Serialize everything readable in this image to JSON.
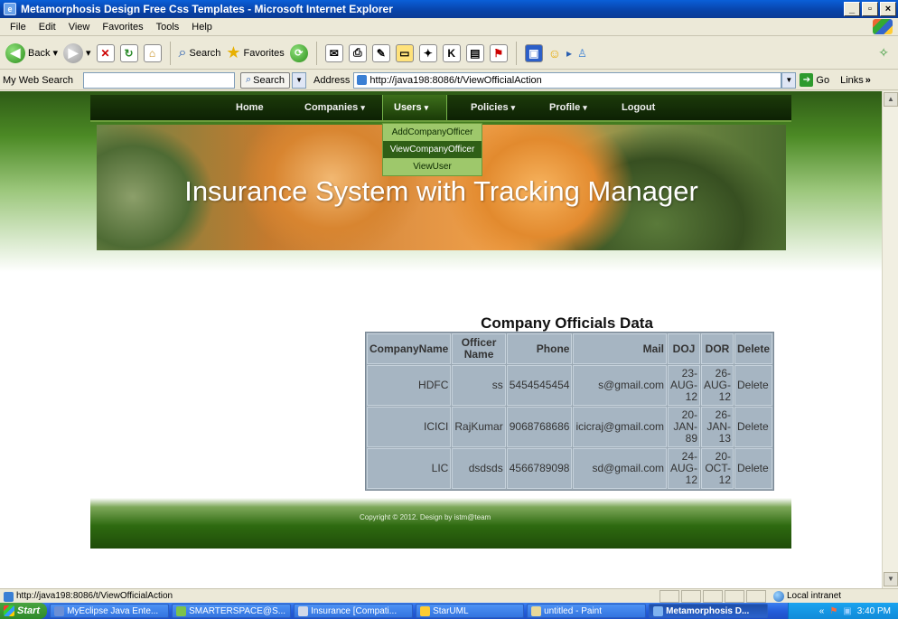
{
  "window": {
    "title": "Metamorphosis Design Free Css Templates - Microsoft Internet Explorer"
  },
  "menubar": [
    "File",
    "Edit",
    "View",
    "Favorites",
    "Tools",
    "Help"
  ],
  "toolbar": {
    "back": "Back",
    "search": "Search",
    "favorites": "Favorites"
  },
  "addressbar": {
    "websearch_label": "My Web Search",
    "search_btn": "Search",
    "address_label": "Address",
    "url": "http://java198:8086/t/ViewOfficialAction",
    "go": "Go",
    "links": "Links"
  },
  "nav": {
    "items": [
      "Home",
      "Companies",
      "Users",
      "Policies",
      "Profile",
      "Logout"
    ],
    "active": "Users"
  },
  "dropdown": {
    "items": [
      "AddCompanyOfficer",
      "ViewCompanyOfficer",
      "ViewUser"
    ],
    "hovered": "ViewCompanyOfficer"
  },
  "banner": {
    "title": "Insurance System with Tracking Manager"
  },
  "table": {
    "title": "Company Officials Data",
    "headers": [
      "CompanyName",
      "Officer Name",
      "Phone",
      "Mail",
      "DOJ",
      "DOR",
      "Delete"
    ],
    "rows": [
      [
        "HDFC",
        "ss",
        "5454545454",
        "s@gmail.com",
        "23-AUG-12",
        "26-AUG-12",
        "Delete"
      ],
      [
        "ICICI",
        "RajKumar",
        "9068768686",
        "icicraj@gmail.com",
        "20-JAN-89",
        "26-JAN-13",
        "Delete"
      ],
      [
        "LIC",
        "dsdsds",
        "4566789098",
        "sd@gmail.com",
        "24-AUG-12",
        "20-OCT-12",
        "Delete"
      ]
    ]
  },
  "footer": {
    "text": "Copyright © 2012. Design by istm@team"
  },
  "statusbar": {
    "url": "http://java198:8086/t/ViewOfficialAction",
    "zone": "Local intranet"
  },
  "taskbar": {
    "start": "Start",
    "tasks": [
      "MyEclipse Java Ente...",
      "SMARTERSPACE@S...",
      "Insurance [Compati...",
      "StarUML",
      "untitled - Paint",
      "Metamorphosis D..."
    ],
    "time": "3:40 PM"
  }
}
